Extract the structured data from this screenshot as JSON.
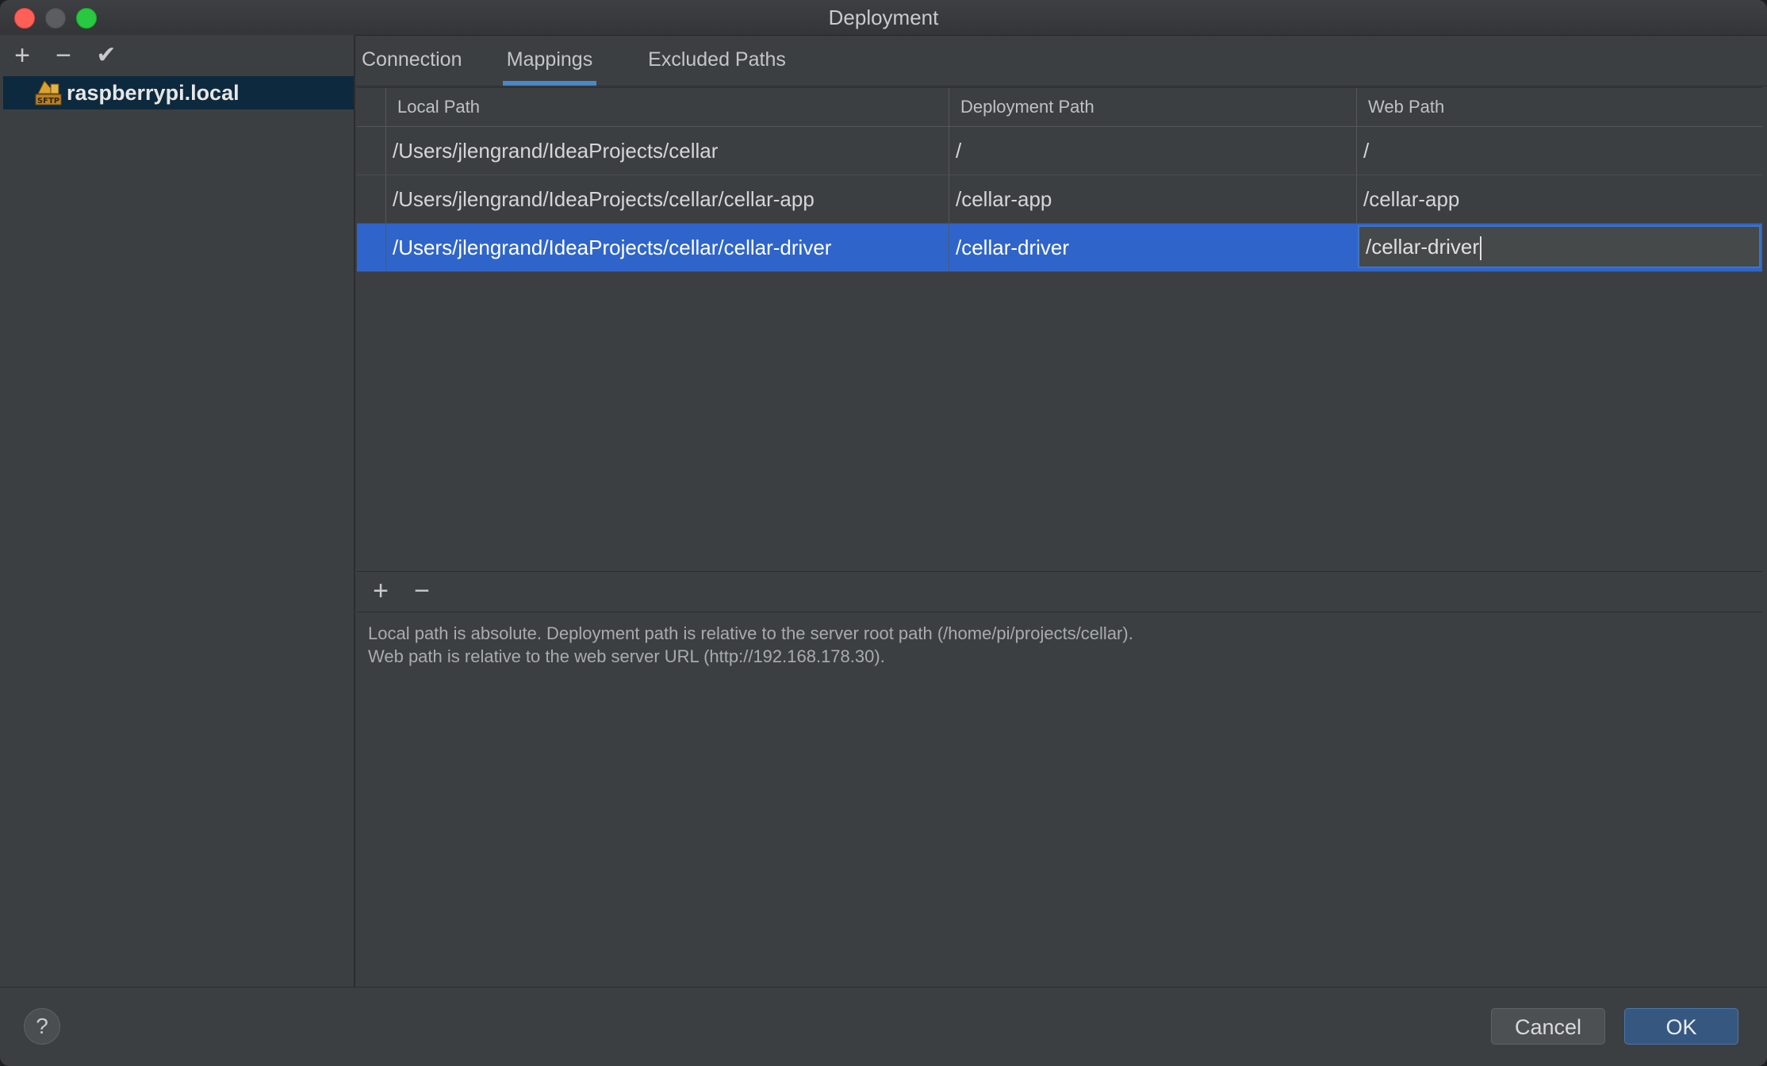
{
  "window": {
    "title": "Deployment"
  },
  "sidebar": {
    "toolbar": {
      "add": "+",
      "remove": "−",
      "default": "✔"
    },
    "servers": [
      {
        "name": "raspberrypi.local",
        "icon": "sftp-icon",
        "icon_text": "SFTP"
      }
    ]
  },
  "tabs": [
    {
      "label": "Connection"
    },
    {
      "label": "Mappings",
      "active": true
    },
    {
      "label": "Excluded Paths"
    }
  ],
  "mappings": {
    "columns": [
      "Local Path",
      "Deployment Path",
      "Web Path"
    ],
    "rows": [
      {
        "local": "/Users/jlengrand/IdeaProjects/cellar",
        "deployment": "/",
        "web": "/"
      },
      {
        "local": "/Users/jlengrand/IdeaProjects/cellar/cellar-app",
        "deployment": "/cellar-app",
        "web": "/cellar-app"
      },
      {
        "local": "/Users/jlengrand/IdeaProjects/cellar/cellar-driver",
        "deployment": "/cellar-driver",
        "web": "/cellar-driver",
        "selected": true
      }
    ],
    "toolbar": {
      "add": "+",
      "remove": "−"
    }
  },
  "hint": {
    "line1": "Local path is absolute. Deployment path is relative to the server root path (/home/pi/projects/cellar).",
    "line2": "Web path is relative to the web server URL (http://192.168.178.30)."
  },
  "footer": {
    "help": "?",
    "cancel": "Cancel",
    "ok": "OK"
  },
  "colors": {
    "accent": "#4a88c7",
    "selection": "#2f65ca",
    "background": "#3c3f41"
  }
}
